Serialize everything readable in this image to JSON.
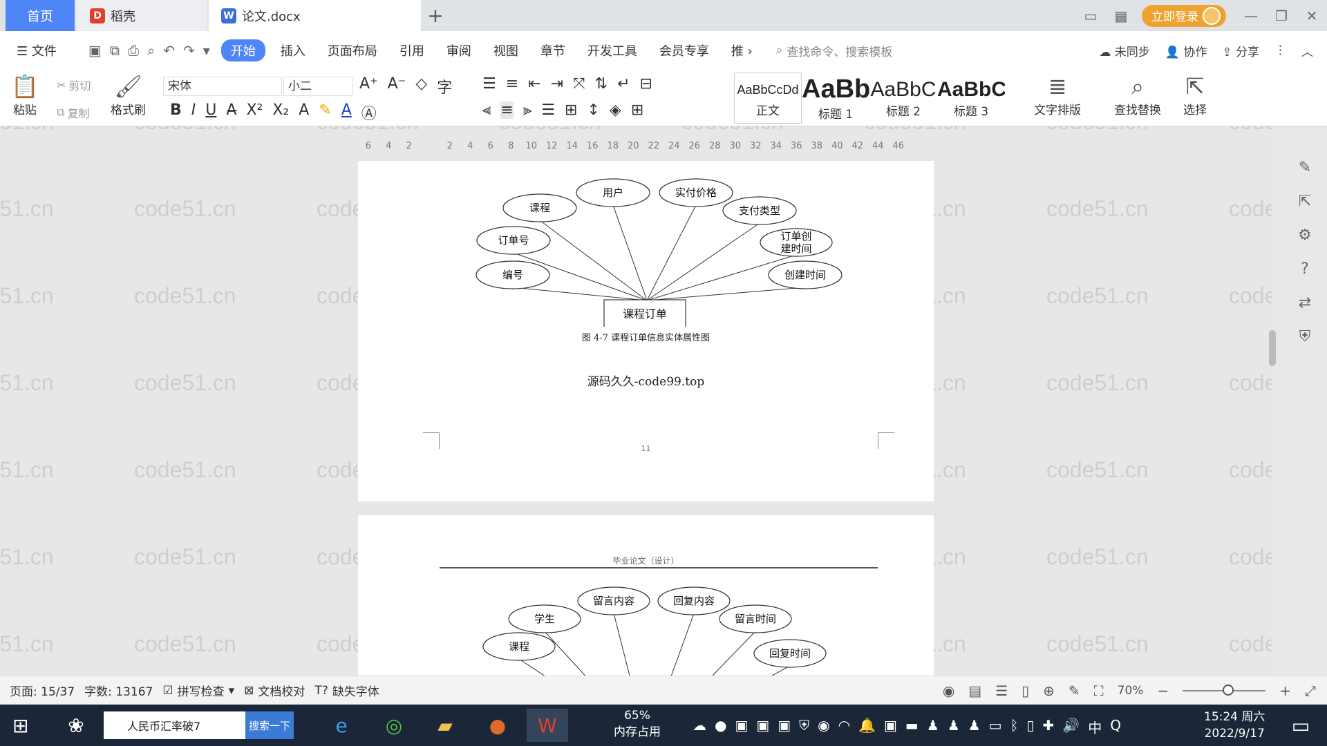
{
  "tabs": {
    "home": "首页",
    "daoke": "稻壳",
    "doc": "论文.docx"
  },
  "titlebar": {
    "login": "立即登录"
  },
  "menu": {
    "file": "文件",
    "items": [
      "开始",
      "插入",
      "页面布局",
      "引用",
      "审阅",
      "视图",
      "章节",
      "开发工具",
      "会员专享",
      "推"
    ],
    "cmd_search": "查找命令、搜索模板",
    "sync": "未同步",
    "collab": "协作",
    "share": "分享"
  },
  "ribbon": {
    "paste": "粘贴",
    "cut": "剪切",
    "copy": "复制",
    "format_painter": "格式刷",
    "font": "宋体",
    "size": "小二",
    "styles": [
      {
        "preview": "AaBbCcDd",
        "name": "正文"
      },
      {
        "preview": "AaBb",
        "name": "标题 1"
      },
      {
        "preview": "AaBbC",
        "name": "标题 2"
      },
      {
        "preview": "AaBbC",
        "name": "标题 3"
      }
    ],
    "text_layout": "文字排版",
    "find_replace": "查找替换",
    "select": "选择"
  },
  "ruler": [
    "6",
    "4",
    "2",
    "",
    "2",
    "4",
    "6",
    "8",
    "10",
    "12",
    "14",
    "16",
    "18",
    "20",
    "22",
    "24",
    "26",
    "28",
    "30",
    "32",
    "34",
    "36",
    "38",
    "40",
    "42",
    "44",
    "46"
  ],
  "document": {
    "diagram1": {
      "entity": "课程订单",
      "attributes": [
        "课程",
        "用户",
        "实付价格",
        "支付类型",
        "订单号",
        "订单创建时间",
        "编号",
        "创建时间"
      ],
      "caption": "图 4-7 课程订单信息实体属性图"
    },
    "source_text": "源码久久-code99.top",
    "page_number": "11",
    "header": "毕业论文（设计）",
    "diagram2": {
      "attributes": [
        "学生",
        "留言内容",
        "回复内容",
        "留言时间",
        "课程",
        "回复时间"
      ]
    },
    "watermark": "code51.cn"
  },
  "statusbar": {
    "page": "页面: 15/37",
    "words": "字数: 13167",
    "spellcheck": "拼写检查",
    "proofread": "文档校对",
    "missing_fonts": "缺失字体",
    "zoom": "70%",
    "zoom_level": 0.5
  },
  "taskbar": {
    "search_text": "人民币汇率破7",
    "search_button": "搜索一下",
    "memory_percent": "65%",
    "memory_label": "内存占用",
    "time": "15:24 周六",
    "date": "2022/9/17",
    "ime": "中"
  },
  "colors": {
    "accent": "#4f86f7",
    "login": "#f0a230",
    "taskbar": "#1b2738"
  }
}
